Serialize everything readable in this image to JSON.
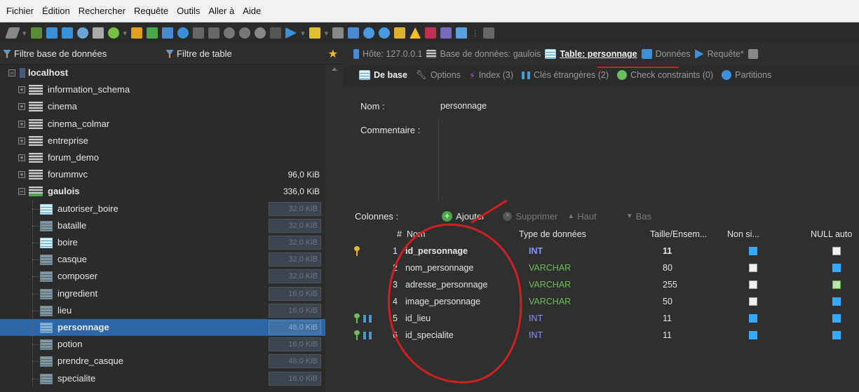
{
  "menu": [
    "Fichier",
    "Édition",
    "Rechercher",
    "Requête",
    "Outils",
    "Aller à",
    "Aide"
  ],
  "filters": {
    "db_filter": "Filtre base de données",
    "table_filter": "Filtre de table"
  },
  "tree": {
    "host": "localhost",
    "databases": [
      {
        "name": "information_schema",
        "size": ""
      },
      {
        "name": "cinema",
        "size": ""
      },
      {
        "name": "cinema_colmar",
        "size": ""
      },
      {
        "name": "entreprise",
        "size": ""
      },
      {
        "name": "forum_demo",
        "size": ""
      },
      {
        "name": "forummvc",
        "size": "96,0 KiB"
      }
    ],
    "open_db": {
      "name": "gaulois",
      "size": "336,0 KiB"
    },
    "tables": [
      {
        "name": "autoriser_boire",
        "size": "32,0 KiB"
      },
      {
        "name": "bataille",
        "size": "32,0 KiB"
      },
      {
        "name": "boire",
        "size": "32,0 KiB"
      },
      {
        "name": "casque",
        "size": "32,0 KiB"
      },
      {
        "name": "composer",
        "size": "32,0 KiB"
      },
      {
        "name": "ingredient",
        "size": "16,0 KiB"
      },
      {
        "name": "lieu",
        "size": "16,0 KiB"
      },
      {
        "name": "personnage",
        "size": "48,0 KiB"
      },
      {
        "name": "potion",
        "size": "16,0 KiB"
      },
      {
        "name": "prendre_casque",
        "size": "48,0 KiB"
      },
      {
        "name": "specialite",
        "size": "16,0 KiB"
      }
    ]
  },
  "tabs": {
    "host": "Hôte: 127.0.0.1",
    "database": "Base de données: gaulois",
    "table": "Table: personnage",
    "data": "Données",
    "query": "Requête*"
  },
  "subtabs": {
    "basic": "De base",
    "options": "Options",
    "index": "Index (3)",
    "foreign": "Clés étrangères (2)",
    "check": "Check constraints (0)",
    "partitions": "Partitions"
  },
  "form": {
    "name_label": "Nom :",
    "name_value": "personnage",
    "comment_label": "Commentaire :"
  },
  "columns_bar": {
    "label": "Colonnes :",
    "add": "Ajouter",
    "remove": "Supprimer",
    "up": "Haut",
    "down": "Bas"
  },
  "columns_header": {
    "num": "#",
    "name": "Nom",
    "type": "Type de données",
    "size": "Taille/Ensem...",
    "unsigned": "Non si...",
    "null": "NULL auto"
  },
  "columns": [
    {
      "num": "1",
      "name": "id_personnage",
      "type": "INT",
      "size": "11",
      "unsigned": true,
      "allow_null": false
    },
    {
      "num": "2",
      "name": "nom_personnage",
      "type": "VARCHAR",
      "size": "80",
      "unsigned": false,
      "allow_null": false
    },
    {
      "num": "3",
      "name": "adresse_personnage",
      "type": "VARCHAR",
      "size": "255",
      "unsigned": false,
      "allow_null": true
    },
    {
      "num": "4",
      "name": "image_personnage",
      "type": "VARCHAR",
      "size": "50",
      "unsigned": false,
      "allow_null": false
    },
    {
      "num": "5",
      "name": "id_lieu",
      "type": "INT",
      "size": "11",
      "unsigned": true,
      "allow_null": false
    },
    {
      "num": "6",
      "name": "id_specialite",
      "type": "INT",
      "size": "11",
      "unsigned": true,
      "allow_null": false
    }
  ],
  "colors": {
    "int": "#8a94ff",
    "varchar": "#6abf5a",
    "selection": "#2d66a8",
    "annotation": "#d02020"
  }
}
